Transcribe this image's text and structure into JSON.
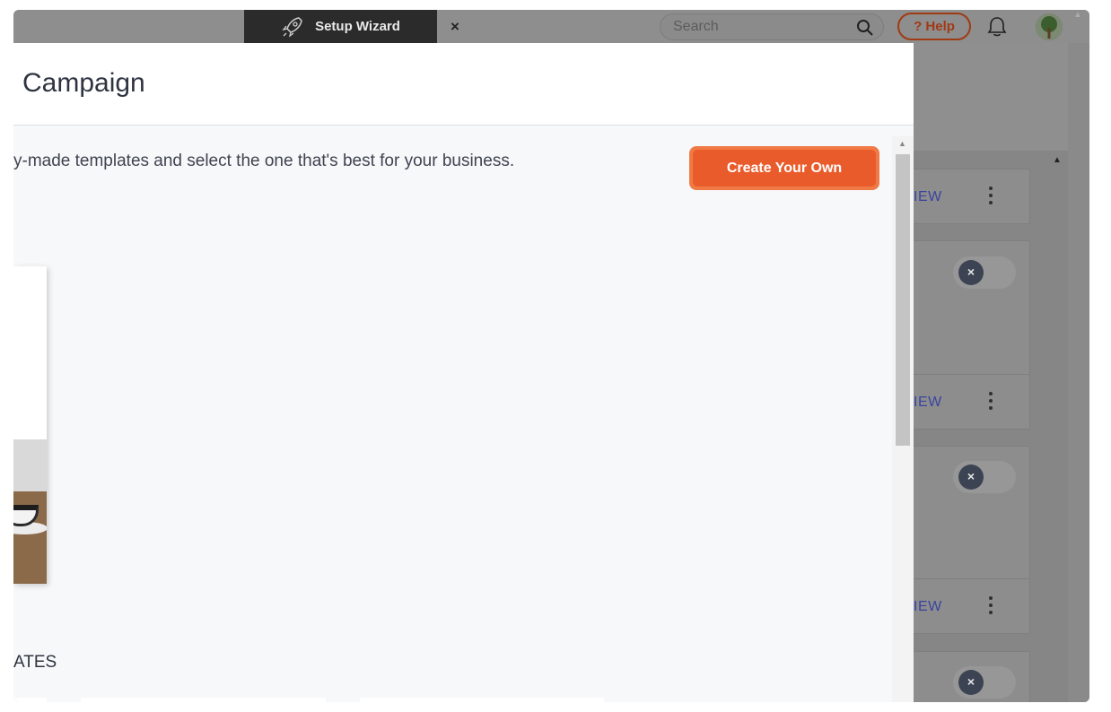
{
  "topbar": {
    "wizard_label": "Setup Wizard",
    "wizard_close": "×",
    "search_placeholder": "Search",
    "help_label": "? Help"
  },
  "modal": {
    "title": "Campaign",
    "subtitle": "y-made templates and select the one that's best for your business.",
    "create_button": "Create Your Own",
    "section_label": "ATES"
  },
  "background_cards": [
    {
      "action": "IEW"
    },
    {
      "action": "IEW"
    },
    {
      "action": "IEW"
    }
  ],
  "toggle_symbol": "×",
  "colors": {
    "accent": "#ea5b2b",
    "help": "#a03a14",
    "link": "#3a44a0"
  }
}
